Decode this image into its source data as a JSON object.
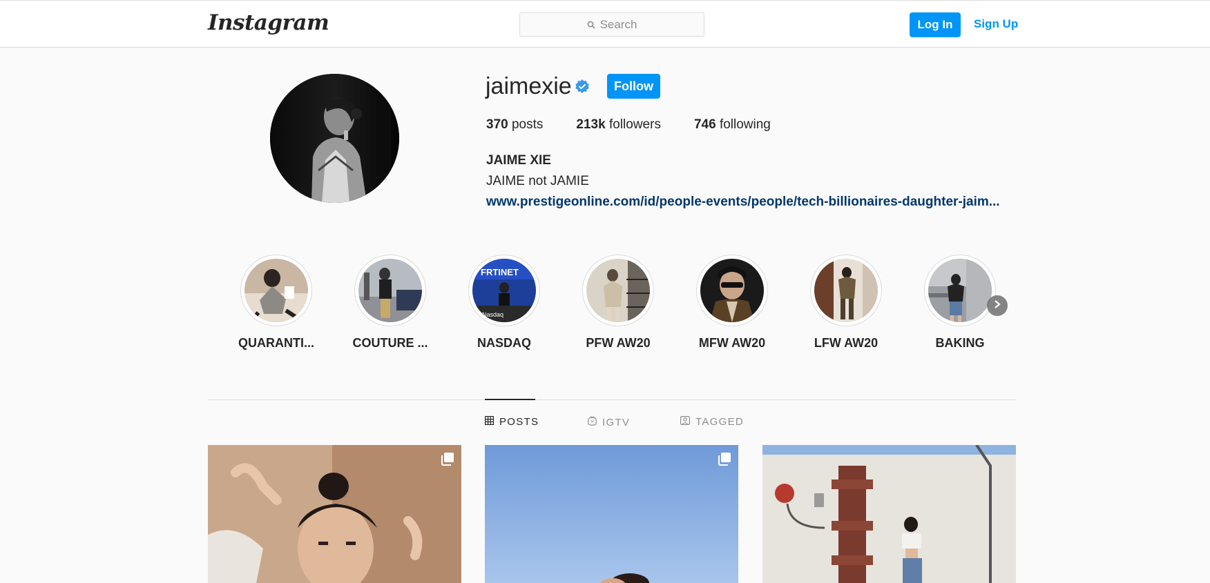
{
  "header": {
    "logo": "Instagram",
    "search_placeholder": "Search",
    "login_label": "Log In",
    "signup_label": "Sign Up",
    "accent_color": "#0095f6"
  },
  "profile": {
    "username": "jaimexie",
    "verified": true,
    "follow_label": "Follow",
    "stats": {
      "posts_count": "370",
      "posts_label": "posts",
      "followers_count": "213k",
      "followers_label": "followers",
      "following_count": "746",
      "following_label": "following"
    },
    "full_name": "JAIME XIE",
    "bio": "JAIME not JAMIE",
    "link": "www.prestigeonline.com/id/people-events/people/tech-billionaires-daughter-jaim..."
  },
  "highlights": [
    {
      "label": "QUARANTI..."
    },
    {
      "label": "COUTURE ..."
    },
    {
      "label": "NASDAQ"
    },
    {
      "label": "PFW AW20"
    },
    {
      "label": "MFW AW20"
    },
    {
      "label": "LFW AW20"
    },
    {
      "label": "BAKING"
    }
  ],
  "tabs": [
    {
      "label": "POSTS",
      "icon": "grid-icon",
      "active": true
    },
    {
      "label": "IGTV",
      "icon": "igtv-icon",
      "active": false
    },
    {
      "label": "TAGGED",
      "icon": "tagged-icon",
      "active": false
    }
  ],
  "posts": [
    {
      "icon": "carousel-icon",
      "multi": true
    },
    {
      "icon": "carousel-icon",
      "multi": true
    },
    {
      "multi": false
    }
  ]
}
